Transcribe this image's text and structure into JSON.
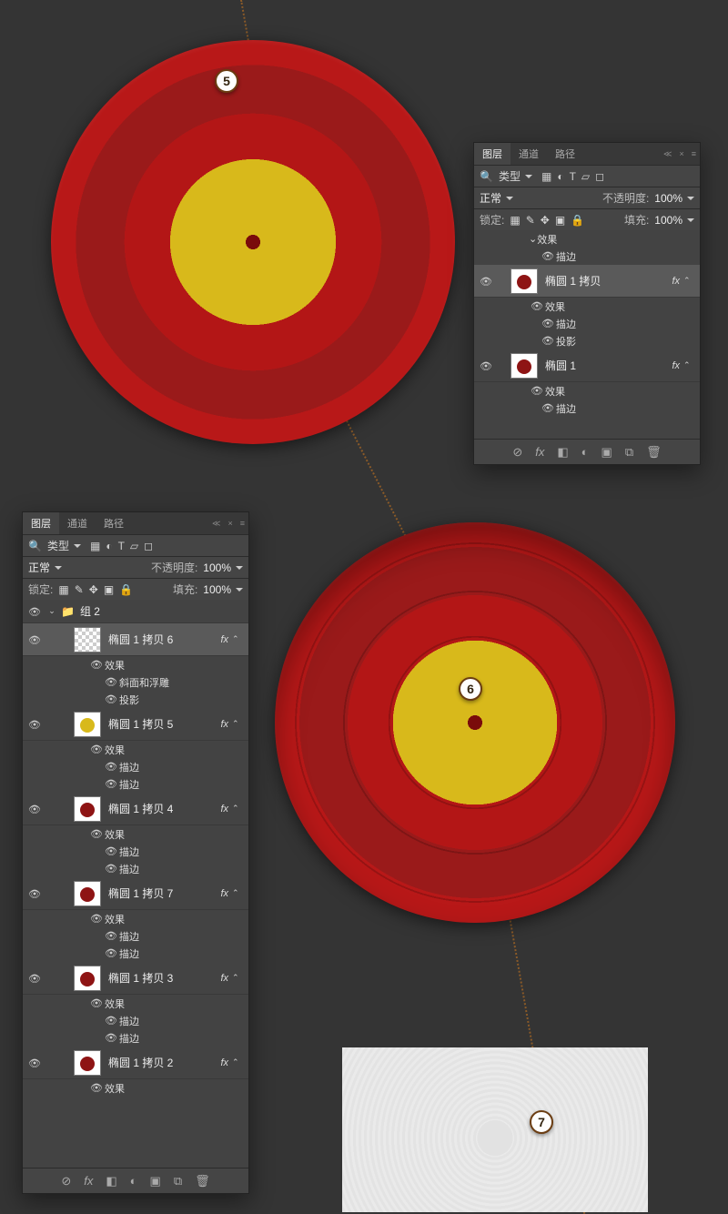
{
  "steps": {
    "a": "5",
    "b": "6",
    "c": "7"
  },
  "panel1": {
    "tabs": [
      "图层",
      "通道",
      "路径"
    ],
    "activeTab": 0,
    "search_label": "类型",
    "search_icon": "🔍",
    "filter_icons": [
      "▦",
      "◐",
      "T",
      "▱",
      "◻"
    ],
    "blend_mode": "正常",
    "opacity_label": "不透明度:",
    "opacity_value": "100%",
    "lock_label": "锁定:",
    "lock_icons": [
      "▦",
      "✎",
      "✥",
      "▣",
      "🔒"
    ],
    "fill_label": "填充:",
    "fill_value": "100%",
    "effects_label": "效果",
    "stroke_label": "描边",
    "shadow_label": "投影",
    "fx_abbrev": "fx",
    "layers": [
      {
        "name_text": "椭圆 1 拷贝",
        "selected": true,
        "eff": [
          "描边",
          "投影"
        ]
      },
      {
        "name_text": "椭圆 1",
        "selected": false,
        "eff": [
          "描边"
        ]
      }
    ],
    "footer_icons": [
      "⊘",
      "fx",
      "◧",
      "◐",
      "▣",
      "⧉",
      "🗑"
    ]
  },
  "panel2": {
    "tabs": [
      "图层",
      "通道",
      "路径"
    ],
    "activeTab": 0,
    "search_label": "类型",
    "search_icon": "🔍",
    "filter_icons": [
      "▦",
      "◐",
      "T",
      "▱",
      "◻"
    ],
    "blend_mode": "正常",
    "opacity_label": "不透明度:",
    "opacity_value": "100%",
    "lock_label": "锁定:",
    "lock_icons": [
      "▦",
      "✎",
      "✥",
      "▣",
      "🔒"
    ],
    "fill_label": "填充:",
    "fill_value": "100%",
    "group_name": "组 2",
    "effects_label": "效果",
    "stroke_label": "描边",
    "bevel_label": "斜面和浮雕",
    "shadow_label": "投影",
    "fx_abbrev": "fx",
    "layers": [
      {
        "name_text": "椭圆 1 拷贝 6",
        "thumb": "trans",
        "selected": true,
        "eff": [
          "斜面和浮雕",
          "投影"
        ]
      },
      {
        "name_text": "椭圆 1 拷贝 5",
        "thumb": "yellow",
        "selected": false,
        "eff": [
          "描边",
          "描边"
        ]
      },
      {
        "name_text": "椭圆 1 拷贝 4",
        "thumb": "red",
        "selected": false,
        "eff": [
          "描边",
          "描边"
        ]
      },
      {
        "name_text": "椭圆 1 拷贝 7",
        "thumb": "red",
        "selected": false,
        "eff": [
          "描边",
          "描边"
        ]
      },
      {
        "name_text": "椭圆 1 拷贝 3",
        "thumb": "red",
        "selected": false,
        "eff": [
          "描边",
          "描边"
        ]
      },
      {
        "name_text": "椭圆 1 拷贝 2",
        "thumb": "red",
        "selected": false,
        "eff": []
      }
    ],
    "footer_icons": [
      "⊘",
      "fx",
      "◧",
      "◐",
      "▣",
      "⧉",
      "🗑"
    ]
  }
}
